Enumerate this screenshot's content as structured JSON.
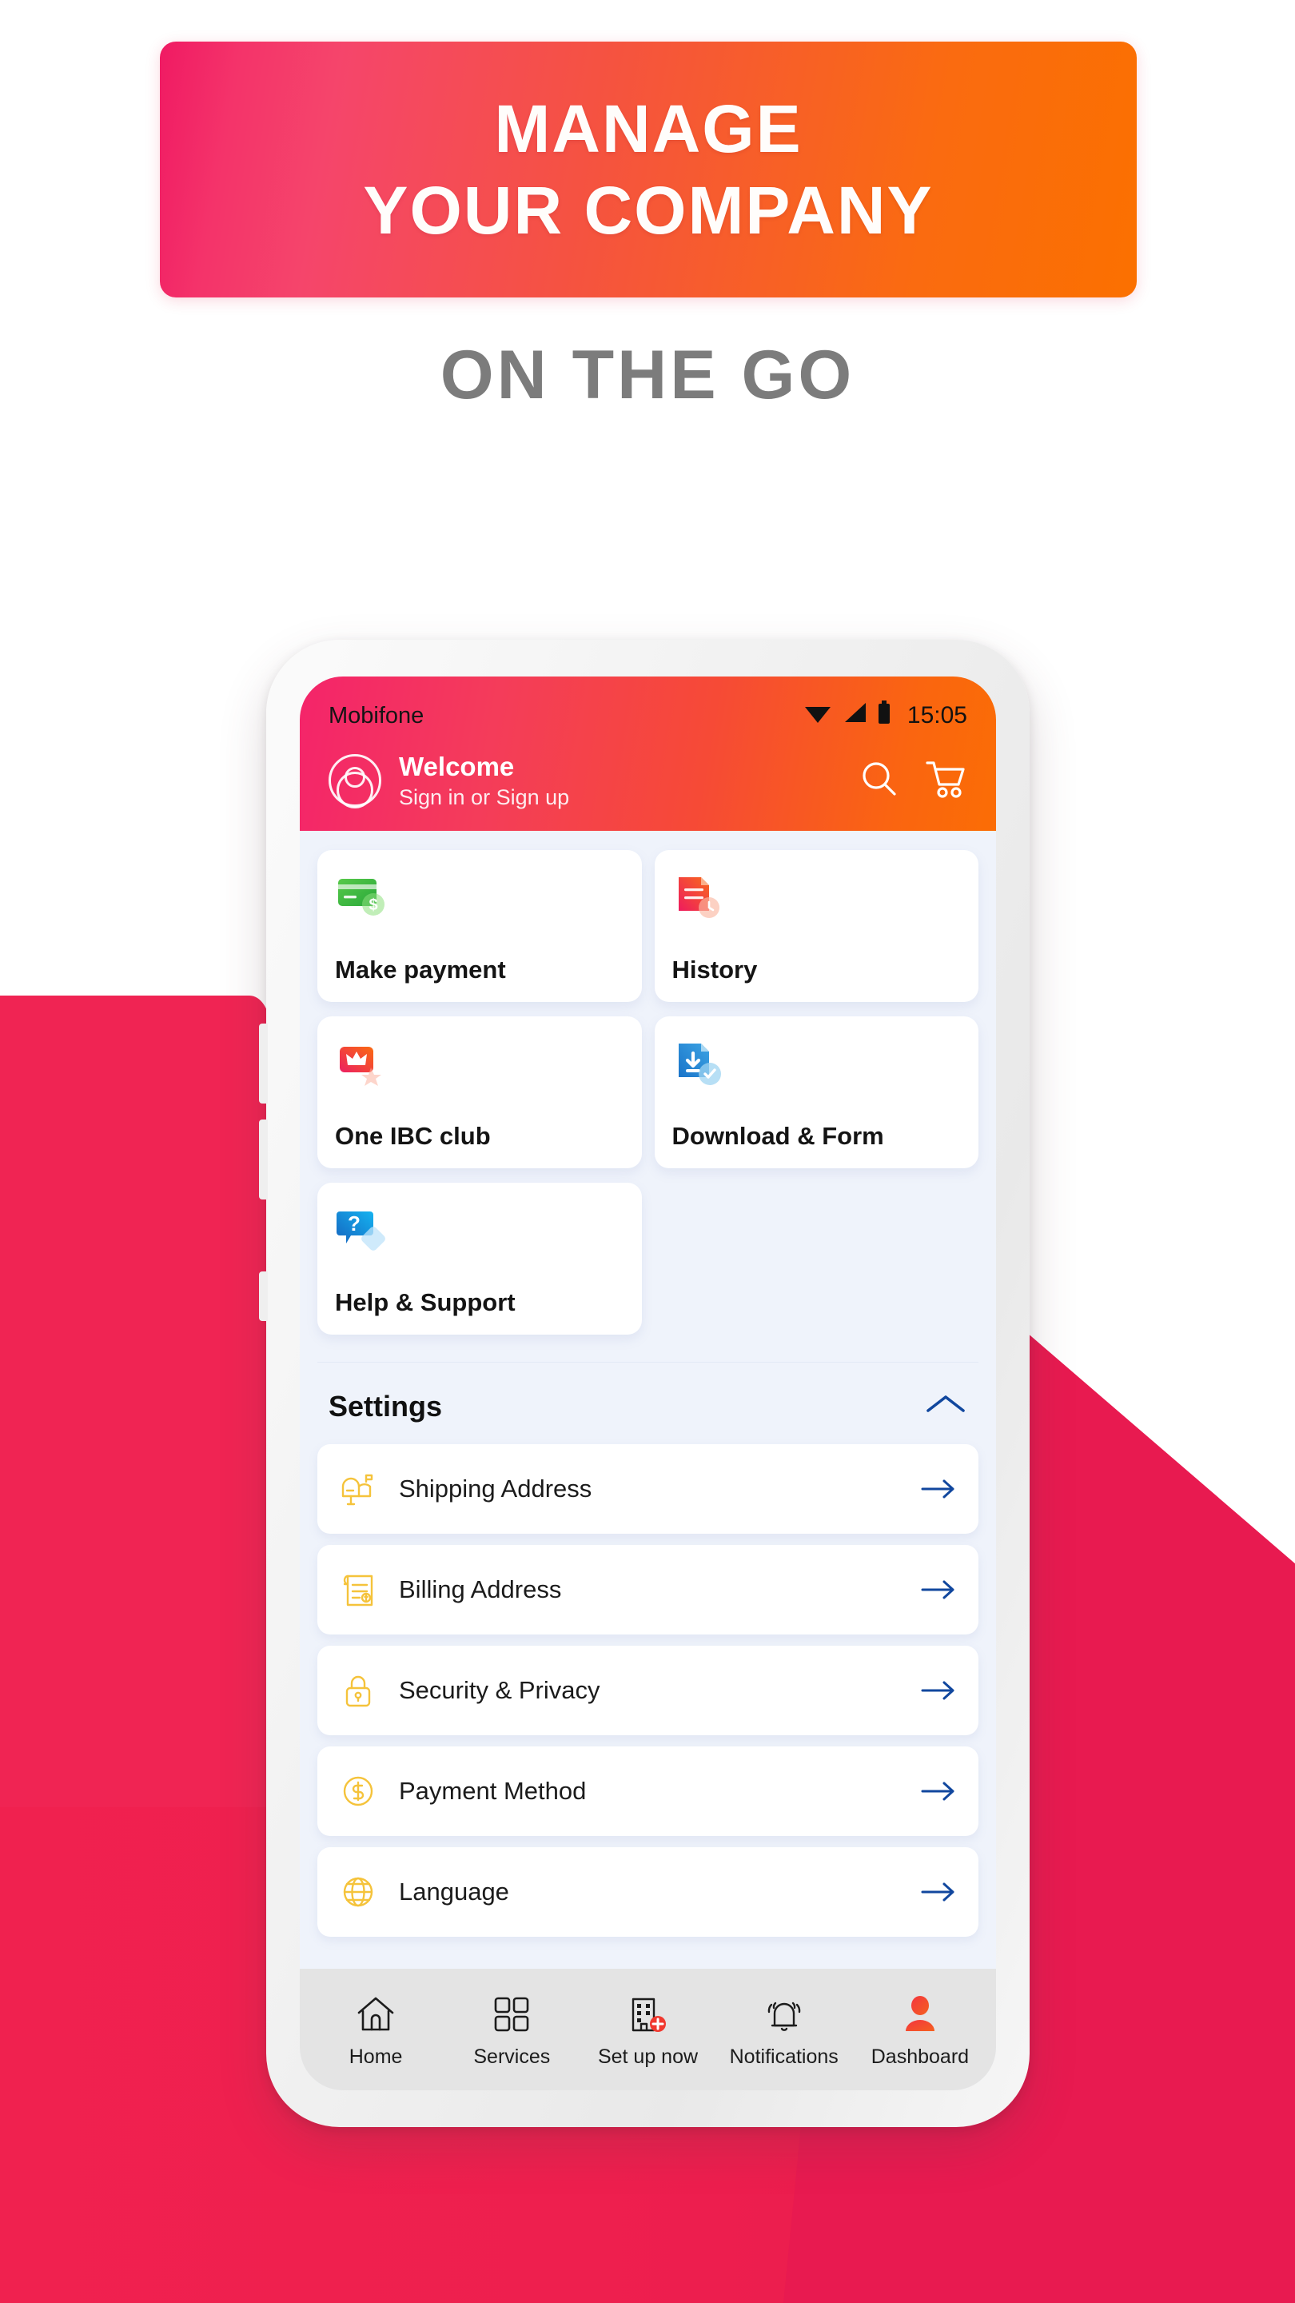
{
  "promo": {
    "headline_line1": "MANAGE",
    "headline_line2": "YOUR COMPANY",
    "subheadline": "ON THE GO",
    "banner_gradient_start": "#f01a63",
    "banner_gradient_end": "#fb7000",
    "subheadline_color": "#7c7c7c",
    "background_accent": "#f02453"
  },
  "phone": {
    "status_bar": {
      "carrier": "Mobifone",
      "time": "15:05",
      "icons": [
        "wifi-icon",
        "signal-icon",
        "battery-icon"
      ]
    },
    "header": {
      "welcome_title": "Welcome",
      "welcome_subtitle": "Sign in or Sign up",
      "avatar_icon": "user-avatar-icon",
      "actions": [
        {
          "name": "search-icon",
          "label": "Search"
        },
        {
          "name": "cart-icon",
          "label": "Cart"
        }
      ],
      "gradient_start": "#f4246a",
      "gradient_end": "#fb6d05"
    },
    "tiles": [
      {
        "label": "Make payment",
        "icon": "credit-card-dollar-icon"
      },
      {
        "label": "History",
        "icon": "document-clock-icon"
      },
      {
        "label": "One IBC club",
        "icon": "crown-star-icon"
      },
      {
        "label": "Download & Form",
        "icon": "document-download-check-icon"
      },
      {
        "label": "Help & Support",
        "icon": "question-bubble-icon"
      }
    ],
    "settings": {
      "title": "Settings",
      "collapse_icon": "chevron-up-icon",
      "collapse_color": "#11479e",
      "arrow_color": "#11479e",
      "icon_color": "#f5c33b",
      "rows": [
        {
          "label": "Shipping Address",
          "icon": "mailbox-icon",
          "arrow": "arrow-right-icon"
        },
        {
          "label": "Billing Address",
          "icon": "invoice-icon",
          "arrow": "arrow-right-icon"
        },
        {
          "label": "Security & Privacy",
          "icon": "padlock-icon",
          "arrow": "arrow-right-icon"
        },
        {
          "label": "Payment Method",
          "icon": "dollar-circle-icon",
          "arrow": "arrow-right-icon"
        },
        {
          "label": "Language",
          "icon": "globe-icon",
          "arrow": "arrow-right-icon"
        }
      ]
    },
    "bottom_nav": {
      "background": "#e4e4e4",
      "active_item": "Dashboard",
      "items": [
        {
          "label": "Home",
          "icon": "home-icon",
          "active": false
        },
        {
          "label": "Services",
          "icon": "grid-squares-icon",
          "active": false
        },
        {
          "label": "Set up now",
          "icon": "building-plus-icon",
          "active": false
        },
        {
          "label": "Notifications",
          "icon": "bell-icon",
          "active": false
        },
        {
          "label": "Dashboard",
          "icon": "user-person-icon",
          "active": true
        }
      ]
    }
  }
}
